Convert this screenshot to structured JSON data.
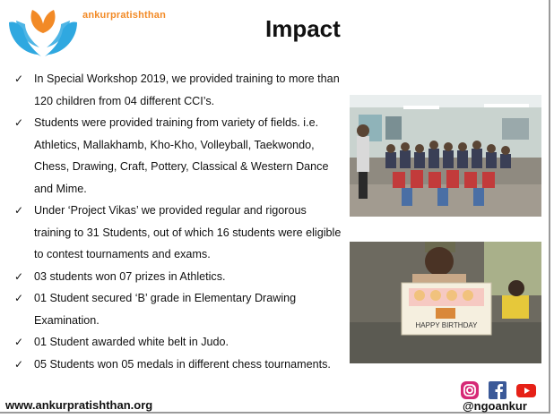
{
  "header": {
    "brand_name": "ankurpratishthan",
    "title": "Impact"
  },
  "bullets": [
    "In Special Workshop 2019, we provided training to more than 120 children from 04 different CCI’s.",
    "Students were provided training from variety of fields. i.e. Athletics, Mallakhamb, Kho-Kho, Volleyball, Taekwondo, Chess, Drawing, Craft, Pottery, Classical & Western Dance and Mime.",
    "Under ‘Project Vikas’ we provided regular and rigorous training to 31 Students, out of which 16 students were eligible to contest tournaments and exams.",
    "03 students won 07 prizes in Athletics.",
    "01 Student secured ‘B’ grade in Elementary Drawing Examination.",
    "01 Student awarded white belt in Judo.",
    "05 Students won 05 medals in different chess tournaments."
  ],
  "photo2_card_text": "HAPPY BIRTHDAY",
  "footer": {
    "website": "www.ankurpratishthan.org",
    "handle": "@ngoankur"
  },
  "social_icons": [
    "instagram-icon",
    "facebook-icon",
    "youtube-icon"
  ],
  "colors": {
    "logo_orange": "#f28a26",
    "logo_blue": "#2fa8e0",
    "instagram": "#d62976",
    "facebook": "#3b5998",
    "youtube": "#e62117"
  }
}
